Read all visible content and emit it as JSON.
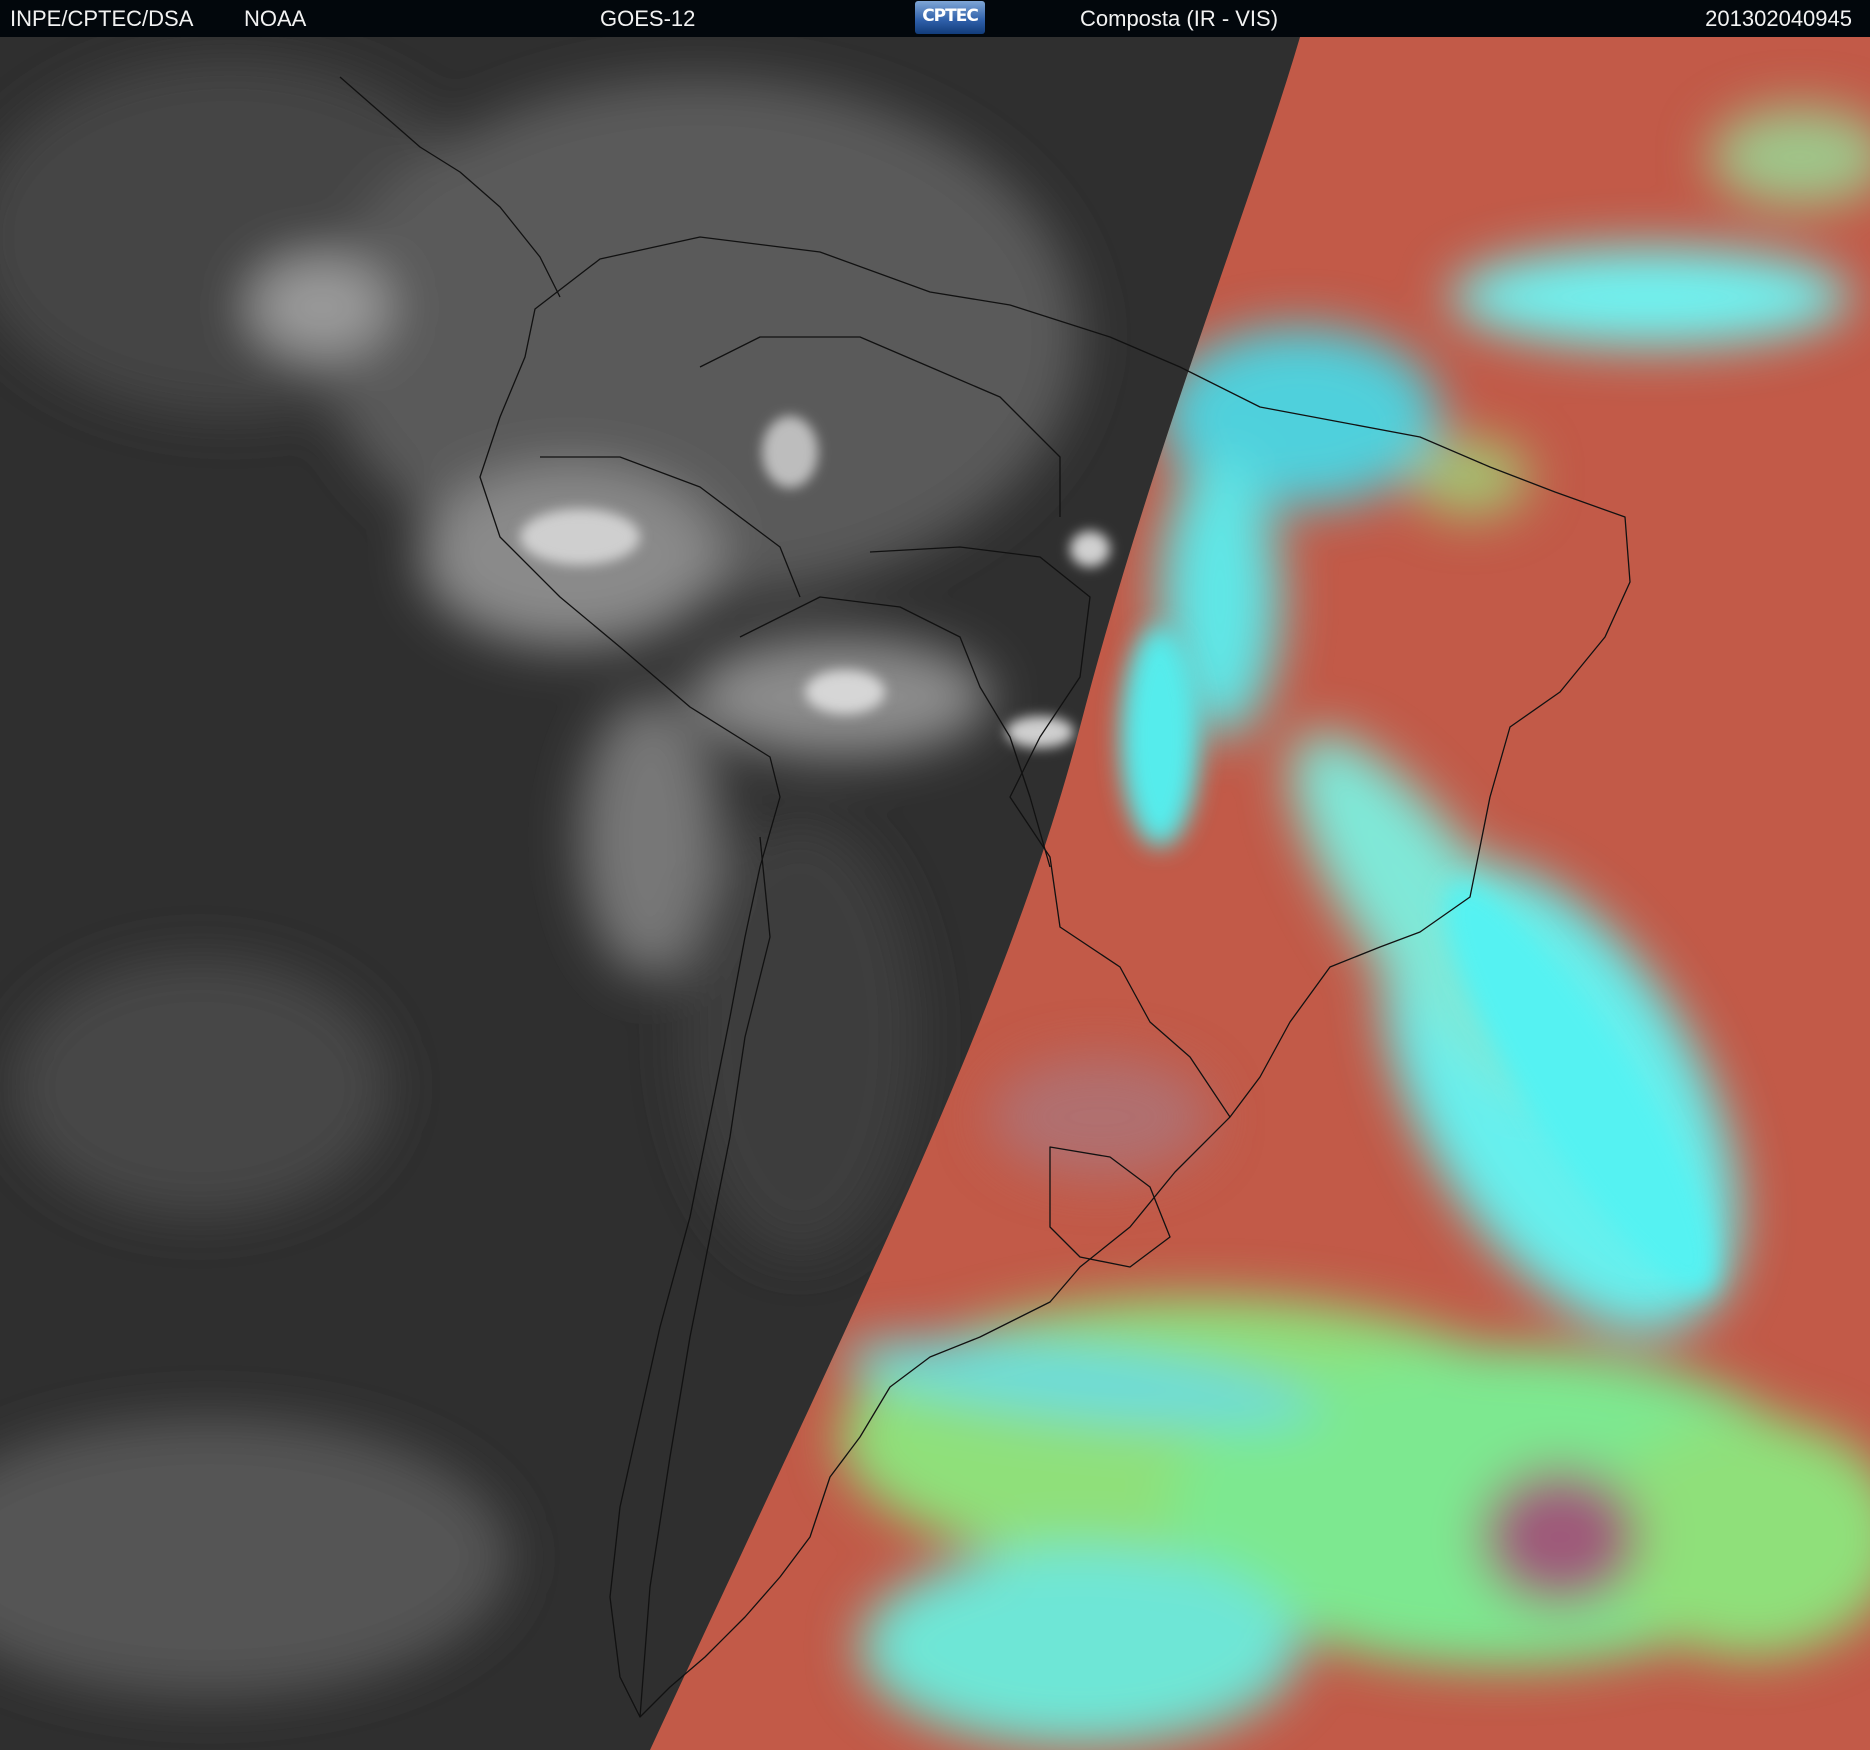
{
  "header": {
    "organization": "INPE/CPTEC/DSA",
    "agency": "NOAA",
    "satellite": "GOES-12",
    "logo_text": "CPTEC",
    "product": "Composta (IR - VIS)",
    "timestamp": "201302040945"
  },
  "map": {
    "colors": {
      "header_bg": "#02070c",
      "ir_background": "#2f2f2f",
      "ir_cloud": "#d8d8d8",
      "vis_surface": "#c25a48",
      "vis_low_cloud": "#5fe8e8",
      "vis_mid_cloud": "#8fe07a",
      "boundary": "#111111"
    }
  }
}
